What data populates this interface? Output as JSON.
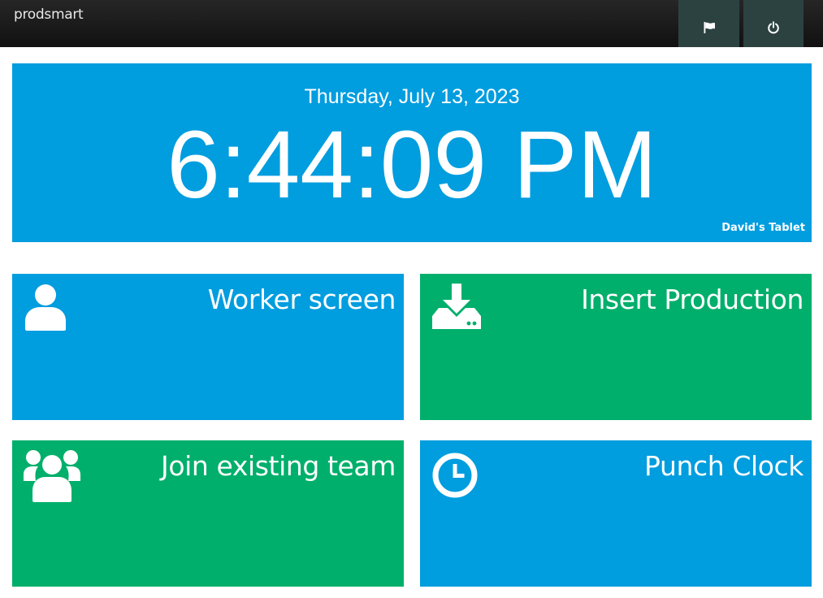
{
  "header": {
    "brand": "prodsmart",
    "buttons": [
      {
        "icon": "flag-icon"
      },
      {
        "icon": "power-icon"
      }
    ]
  },
  "clock": {
    "date": "Thursday, July 13, 2023",
    "time": "6:44:09 PM",
    "device": "David's Tablet"
  },
  "tiles": [
    {
      "label": "Worker screen",
      "icon": "user-icon",
      "color": "#009ddf"
    },
    {
      "label": "Insert Production",
      "icon": "download-icon",
      "color": "#00af6b"
    },
    {
      "label": "Join existing team",
      "icon": "users-icon",
      "color": "#00af6b"
    },
    {
      "label": "Punch Clock",
      "icon": "clock-icon",
      "color": "#009ddf"
    }
  ]
}
